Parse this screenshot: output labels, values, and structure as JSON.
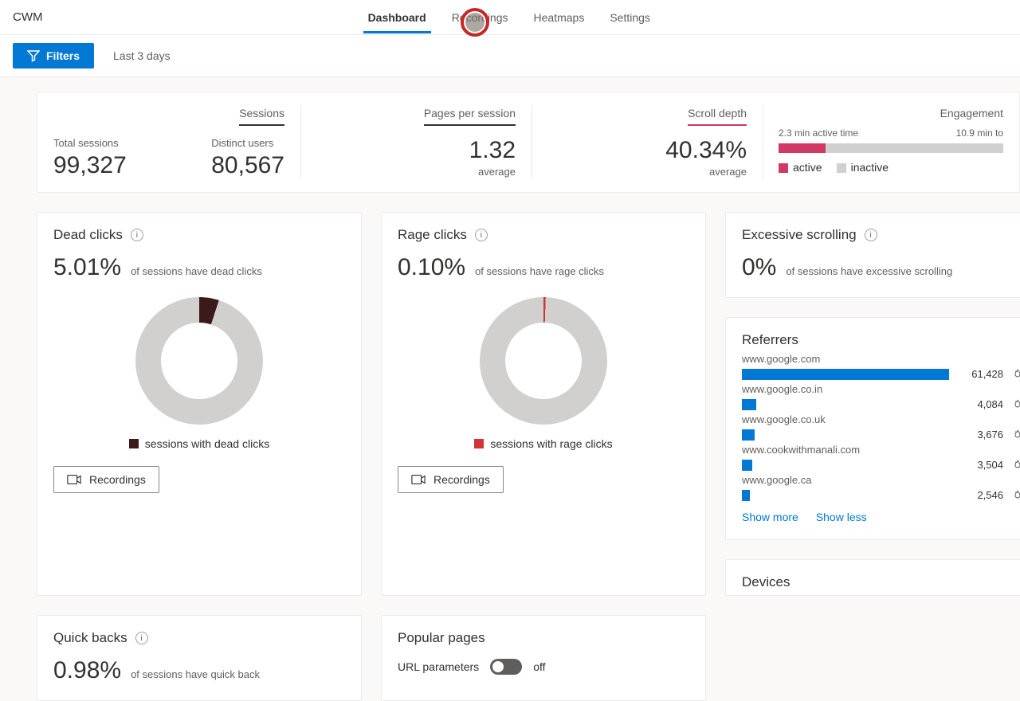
{
  "brand": "CWM",
  "nav": {
    "dashboard": "Dashboard",
    "recordings": "Recordings",
    "heatmaps": "Heatmaps",
    "settings": "Settings"
  },
  "toolbar": {
    "filters": "Filters",
    "range": "Last 3 days"
  },
  "summary": {
    "sessions": {
      "title": "Sessions",
      "total_label": "Total sessions",
      "total_value": "99,327",
      "distinct_label": "Distinct users",
      "distinct_value": "80,567"
    },
    "pps": {
      "title": "Pages per session",
      "value": "1.32",
      "sub": "average"
    },
    "scroll": {
      "title": "Scroll depth",
      "value": "40.34%",
      "sub": "average"
    },
    "engage": {
      "title": "Engagement",
      "active_label": "2.3 min active time",
      "inactive_label": "10.9 min to",
      "active_pct": 21,
      "legend_active": "active",
      "legend_inactive": "inactive"
    }
  },
  "cards": {
    "dead": {
      "title": "Dead clicks",
      "pct": "5.01%",
      "desc": "of sessions have dead clicks",
      "legend": "sessions with dead clicks",
      "color": "#3b1a1a",
      "slice_pct": 5.01,
      "rec": "Recordings"
    },
    "rage": {
      "title": "Rage clicks",
      "pct": "0.10%",
      "desc": "of sessions have rage clicks",
      "legend": "sessions with rage clicks",
      "color": "#d13438",
      "slice_pct": 0.6,
      "rec": "Recordings"
    },
    "exscroll": {
      "title": "Excessive scrolling",
      "pct": "0%",
      "desc": "of sessions have excessive scrolling"
    },
    "quick": {
      "title": "Quick backs",
      "pct": "0.98%",
      "desc": "of sessions have quick back"
    },
    "popular": {
      "title": "Popular pages",
      "url_params_label": "URL parameters",
      "toggle_state": "off"
    },
    "devices": {
      "title": "Devices"
    }
  },
  "referrers": {
    "title": "Referrers",
    "items": [
      {
        "domain": "www.google.com",
        "count": "61,428",
        "width": 100
      },
      {
        "domain": "www.google.co.in",
        "count": "4,084",
        "width": 7
      },
      {
        "domain": "www.google.co.uk",
        "count": "3,676",
        "width": 6
      },
      {
        "domain": "www.cookwithmanali.com",
        "count": "3,504",
        "width": 5
      },
      {
        "domain": "www.google.ca",
        "count": "2,546",
        "width": 4
      }
    ],
    "show_more": "Show more",
    "show_less": "Show less"
  },
  "chart_data": [
    {
      "type": "pie",
      "title": "Dead clicks",
      "series": [
        {
          "name": "sessions with dead clicks",
          "value": 5.01
        },
        {
          "name": "other",
          "value": 94.99
        }
      ]
    },
    {
      "type": "pie",
      "title": "Rage clicks",
      "series": [
        {
          "name": "sessions with rage clicks",
          "value": 0.1
        },
        {
          "name": "other",
          "value": 99.9
        }
      ]
    },
    {
      "type": "bar",
      "title": "Referrers",
      "categories": [
        "www.google.com",
        "www.google.co.in",
        "www.google.co.uk",
        "www.cookwithmanali.com",
        "www.google.ca"
      ],
      "values": [
        61428,
        4084,
        3676,
        3504,
        2546
      ]
    }
  ]
}
